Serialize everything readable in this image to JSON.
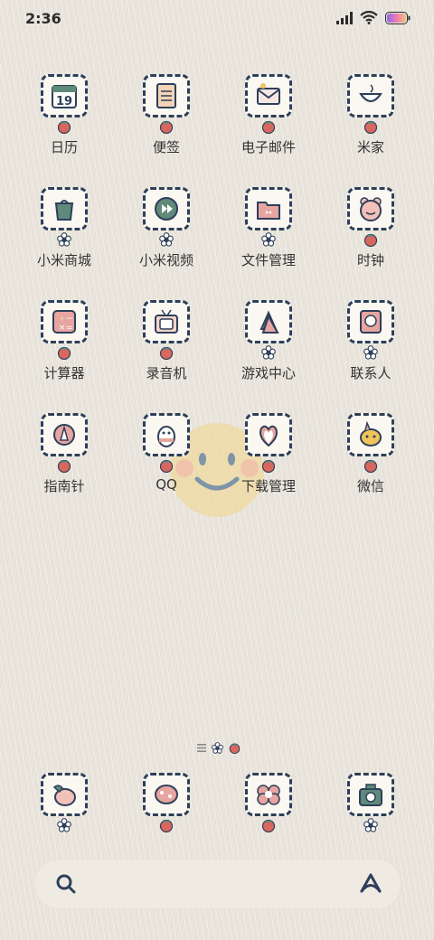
{
  "status": {
    "time": "2:36"
  },
  "apps": [
    {
      "label": "日历",
      "icon": "calendar-icon",
      "badge": "strawberry",
      "calendar_day": "19"
    },
    {
      "label": "便签",
      "icon": "notes-icon",
      "badge": "strawberry"
    },
    {
      "label": "电子邮件",
      "icon": "email-icon",
      "badge": "strawberry"
    },
    {
      "label": "米家",
      "icon": "mihome-icon",
      "badge": "strawberry"
    },
    {
      "label": "小米商城",
      "icon": "shopping-bag-icon",
      "badge": "flower"
    },
    {
      "label": "小米视频",
      "icon": "video-icon",
      "badge": "flower"
    },
    {
      "label": "文件管理",
      "icon": "folder-icon",
      "badge": "flower"
    },
    {
      "label": "时钟",
      "icon": "clock-icon",
      "badge": "strawberry"
    },
    {
      "label": "计算器",
      "icon": "calculator-icon",
      "badge": "strawberry"
    },
    {
      "label": "录音机",
      "icon": "recorder-icon",
      "badge": "strawberry"
    },
    {
      "label": "游戏中心",
      "icon": "game-icon",
      "badge": "flower"
    },
    {
      "label": "联系人",
      "icon": "contacts-icon",
      "badge": "flower"
    },
    {
      "label": "指南针",
      "icon": "compass-icon",
      "badge": "strawberry"
    },
    {
      "label": "QQ",
      "icon": "qq-icon",
      "badge": "strawberry"
    },
    {
      "label": "下载管理",
      "icon": "download-icon",
      "badge": "strawberry"
    },
    {
      "label": "微信",
      "icon": "wechat-icon",
      "badge": "strawberry"
    }
  ],
  "dock": [
    {
      "icon": "phone-icon",
      "badge": "flower"
    },
    {
      "icon": "messages-icon",
      "badge": "strawberry"
    },
    {
      "icon": "browser-icon",
      "badge": "strawberry"
    },
    {
      "icon": "camera-icon",
      "badge": "flower"
    }
  ],
  "colors": {
    "outline": "#2e3f5a",
    "pink": "#e7a5a0",
    "green": "#5f8a7a",
    "yellow": "#f0d89a",
    "background": "#e9e5dc"
  }
}
